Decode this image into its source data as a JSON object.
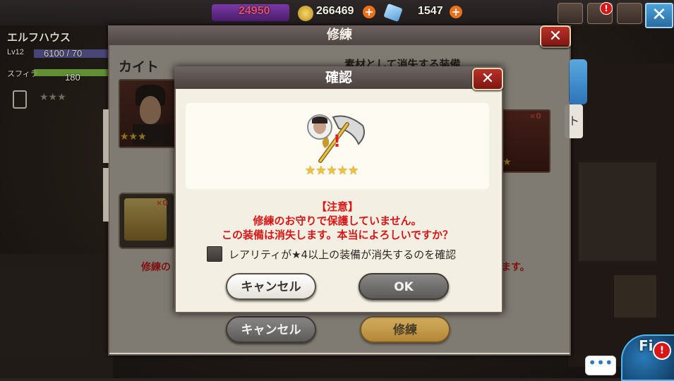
{
  "hud": {
    "stamina_value": "24950",
    "gold_value": "266469",
    "gem_value": "1547"
  },
  "left_panel": {
    "house_name": "エルフハウス",
    "level_label": "Lv12",
    "exp_value": "6100 / 70",
    "stamina_label": "スフィラ",
    "stamina_value": "180",
    "rarity": "★★★"
  },
  "back_window": {
    "title": "修練",
    "character_name": "カイト",
    "material_header": "素材として消失する装備",
    "note_left": "修練の",
    "note_right": "ます。",
    "cancel_label": "キャンセル",
    "train_label": "修練",
    "portrait_stars": "★★★",
    "item_count": "×0",
    "axe_count": "×0",
    "axe_star": "★",
    "side_text": "ト"
  },
  "dialog": {
    "title": "確認",
    "item_stars": "★★★★★",
    "item_alert": "!",
    "notice_title": "【注意】",
    "notice_line1": "修練のお守りで保護していません。",
    "notice_line2": "この装備は消失します。本当によろしいですか？",
    "checkbox_label": "レアリティが★4以上の装備が消失するのを確認",
    "cancel_label": "キャンセル",
    "ok_label": "OK"
  },
  "corner": {
    "chat_dots": "•••",
    "fi_text": "Fi",
    "alert_mark": "!"
  },
  "colors": {
    "warning_red": "#d81616",
    "gold_star": "#f1c232",
    "close_red": "#b93028"
  },
  "icons": [
    "close-icon",
    "gold-coin-icon",
    "gem-icon",
    "plus-icon",
    "mail-icon",
    "gift-icon",
    "chat-icon",
    "axe-icon",
    "ring-icon",
    "alert-icon"
  ]
}
